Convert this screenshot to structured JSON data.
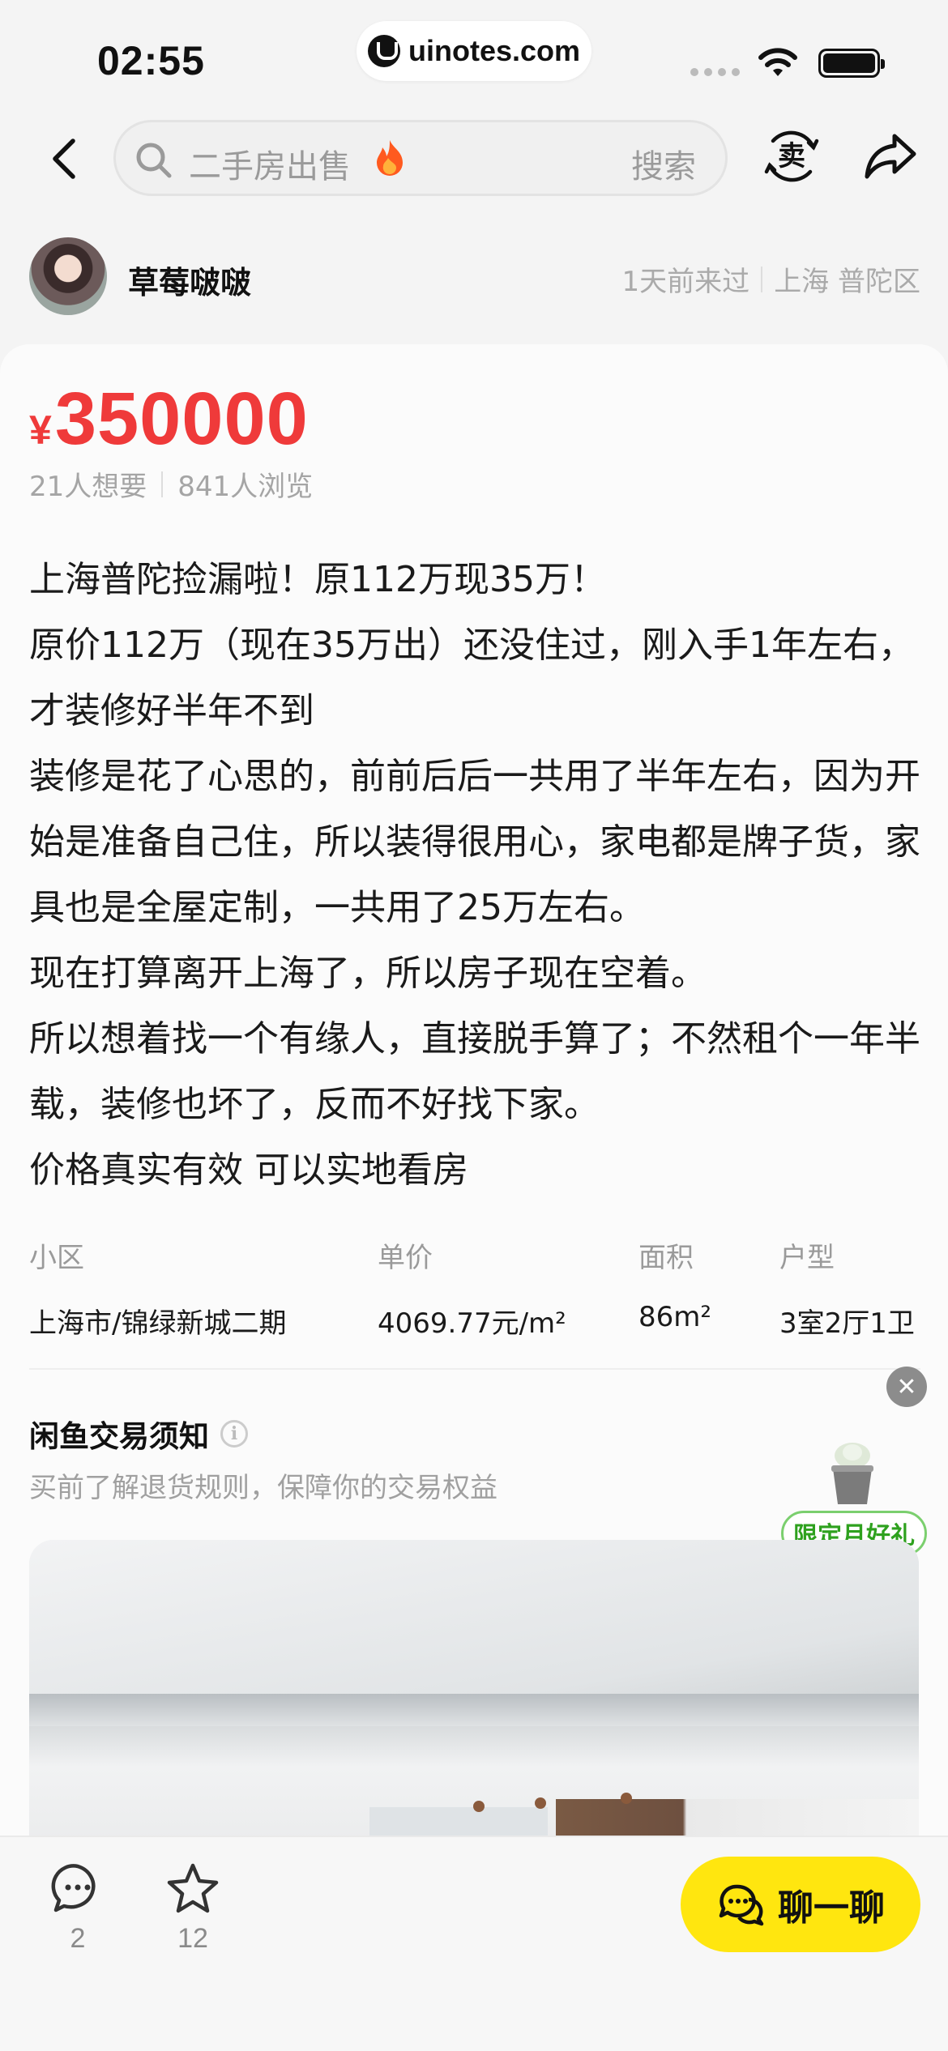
{
  "status_bar": {
    "time": "02:55",
    "watermark": "uinotes.com"
  },
  "nav": {
    "search_placeholder": "二手房出售",
    "search_button": "搜索",
    "sell_label": "卖"
  },
  "seller": {
    "name": "草莓啵啵",
    "last_seen": "1天前来过",
    "location": "上海 普陀区"
  },
  "listing": {
    "currency": "¥",
    "price": "350000",
    "wants": "21人想要",
    "views": "841人浏览",
    "description": [
      "上海普陀捡漏啦！原112万现35万！",
      "原价112万（现在35万出）还没住过，刚入手1年左右，才装修好半年不到",
      "装修是花了心思的，前前后后一共用了半年左右，因为开始是准备自己住，所以装得很用心，家电都是牌子货，家具也是全屋定制，一共用了25万左右。",
      "现在打算离开上海了，所以房子现在空着。",
      "所以想着找一个有缘人，直接脱手算了；不然租个一年半载，装修也坏了，反而不好找下家。",
      "价格真实有效 可以实地看房"
    ],
    "attributes": [
      {
        "label": "小区",
        "value": "上海市/锦绿新城二期"
      },
      {
        "label": "单价",
        "value": "4069.77元/m²"
      },
      {
        "label": "面积",
        "value": "86m²"
      },
      {
        "label": "户型",
        "value": "3室2厅1卫"
      }
    ]
  },
  "notice": {
    "title": "闲鱼交易须知",
    "subtitle": "买前了解退货规则，保障你的交易权益",
    "gift_badge": "限定月好礼"
  },
  "bottom_bar": {
    "comments_count": "2",
    "favorites_count": "12",
    "chat_label": "聊一聊"
  },
  "colors": {
    "price_red": "#ef3a3a",
    "chat_yellow": "#ffe60f",
    "gift_green": "#2ea11e"
  },
  "icons": [
    "back-arrow-icon",
    "search-icon",
    "fire-icon",
    "sell-icon",
    "share-icon",
    "info-icon",
    "close-icon",
    "comment-icon",
    "star-icon",
    "chat-bubble-icon"
  ]
}
